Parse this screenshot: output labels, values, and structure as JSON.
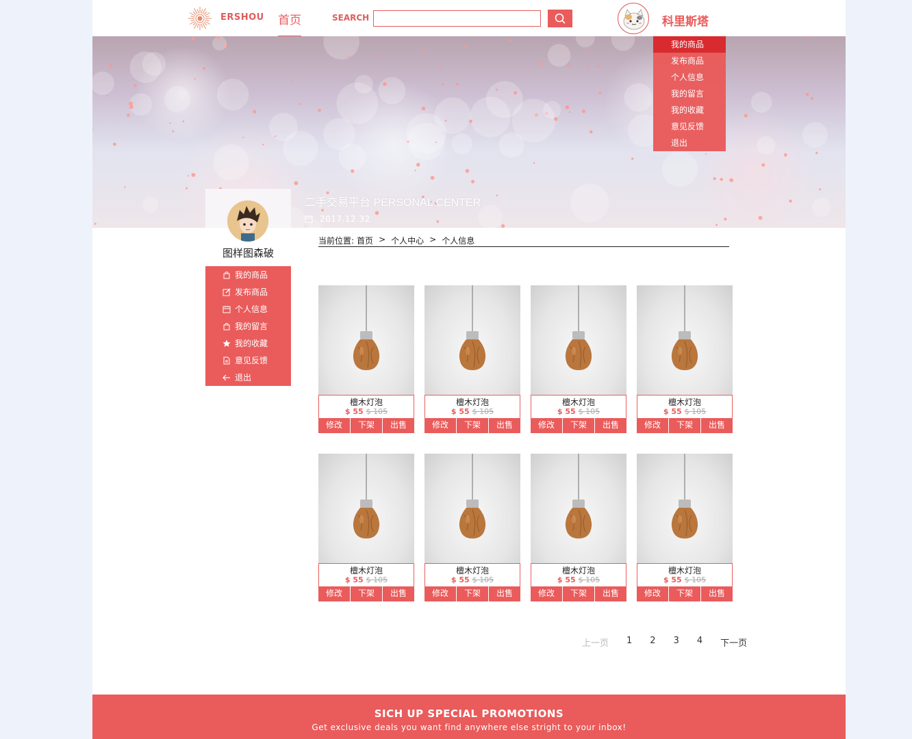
{
  "colors": {
    "accent": "#ea5b5b",
    "accent_dark": "#d9272c",
    "page_bg": "#eef2fb"
  },
  "header": {
    "logo_text": "ERSHOU",
    "nav_home": "首页",
    "search_label": "SEARCH",
    "search_value": "",
    "search_icon": "search-icon",
    "user_name": "科里斯塔"
  },
  "dropdown": {
    "items": [
      "我的商品",
      "发布商品",
      "个人信息",
      "我的留言",
      "我的收藏",
      "意见反馈",
      "退出"
    ],
    "active_index": 0
  },
  "hero": {
    "title": "二手交易平台 PERSONAL CENTER",
    "date": "2017.12.32",
    "date_icon": "calendar-icon"
  },
  "profile": {
    "name": "图样图森破"
  },
  "side_menu": {
    "items": [
      {
        "label": "我的商品",
        "icon": "bag-icon"
      },
      {
        "label": "发布商品",
        "icon": "edit-icon"
      },
      {
        "label": "个人信息",
        "icon": "calendar-icon"
      },
      {
        "label": "我的留言",
        "icon": "bag-icon"
      },
      {
        "label": "我的收藏",
        "icon": "star-icon"
      },
      {
        "label": "意见反馈",
        "icon": "document-icon"
      },
      {
        "label": "退出",
        "icon": "arrow-left-icon"
      }
    ]
  },
  "breadcrumb": {
    "prefix": "当前位置:",
    "items": [
      "首页",
      "个人中心",
      "个人信息"
    ],
    "separator": ">"
  },
  "products": [
    {
      "name": "檀木灯泡",
      "price": "$ 55",
      "old_price": "$ 105"
    },
    {
      "name": "檀木灯泡",
      "price": "$ 55",
      "old_price": "$ 105"
    },
    {
      "name": "檀木灯泡",
      "price": "$ 55",
      "old_price": "$ 105"
    },
    {
      "name": "檀木灯泡",
      "price": "$ 55",
      "old_price": "$ 105"
    },
    {
      "name": "檀木灯泡",
      "price": "$ 55",
      "old_price": "$ 105"
    },
    {
      "name": "檀木灯泡",
      "price": "$ 55",
      "old_price": "$ 105"
    },
    {
      "name": "檀木灯泡",
      "price": "$ 55",
      "old_price": "$ 105"
    },
    {
      "name": "檀木灯泡",
      "price": "$ 55",
      "old_price": "$ 105"
    }
  ],
  "product_actions": [
    "修改",
    "下架",
    "出售"
  ],
  "pagination": {
    "prev": "上一页",
    "pages": [
      "1",
      "2",
      "3",
      "4"
    ],
    "next": "下一页"
  },
  "footer": {
    "title": "SICH UP SPECIAL PROMOTIONS",
    "subtitle": "Get exclusive deals you want find anywhere else stright to your inbox!"
  }
}
